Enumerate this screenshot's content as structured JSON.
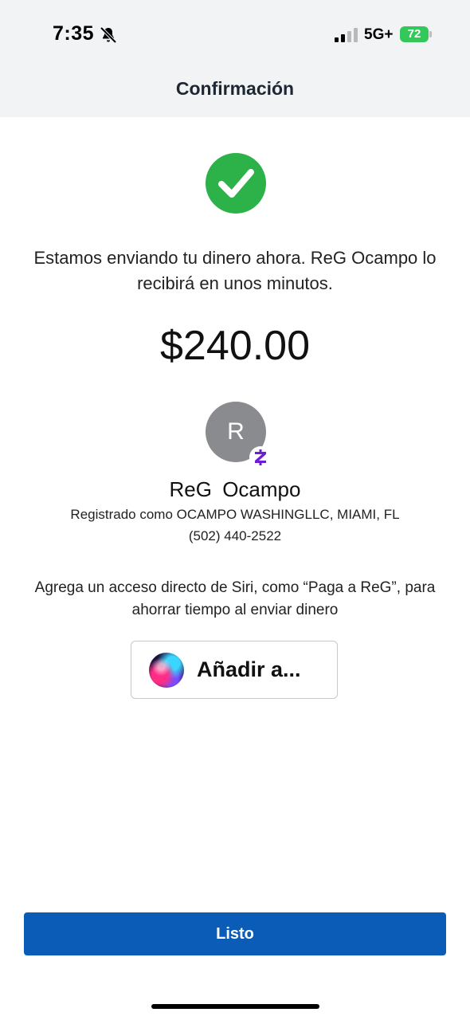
{
  "status_bar": {
    "time": "7:35",
    "network": "5G+",
    "battery": "72",
    "icons": [
      "bell-off-icon",
      "signal-icon"
    ]
  },
  "header": {
    "title": "Confirmación"
  },
  "confirmation": {
    "icon": "check-circle-icon",
    "message": "Estamos enviando tu dinero ahora. ReG Ocampo lo recibirá en unos minutos.",
    "amount": "$240.00"
  },
  "recipient": {
    "initial": "R",
    "name": "ReG  Ocampo",
    "registered_as": "Registrado como OCAMPO WASHINGLLC, MIAMI, FL",
    "phone": "(502) 440-2522",
    "badge_icon": "zelle-icon"
  },
  "siri": {
    "prompt": "Agrega un acceso directo de Siri, como “Paga a ReG”, para ahorrar tiempo al enviar dinero",
    "button_label": "Añadir a...",
    "icon": "siri-icon"
  },
  "footer": {
    "done_label": "Listo"
  },
  "colors": {
    "header_bg": "#f2f3f5",
    "success_green": "#2db24a",
    "primary_blue": "#0b5cb7",
    "zelle_purple": "#6d1ed4",
    "battery_green": "#34c759"
  }
}
